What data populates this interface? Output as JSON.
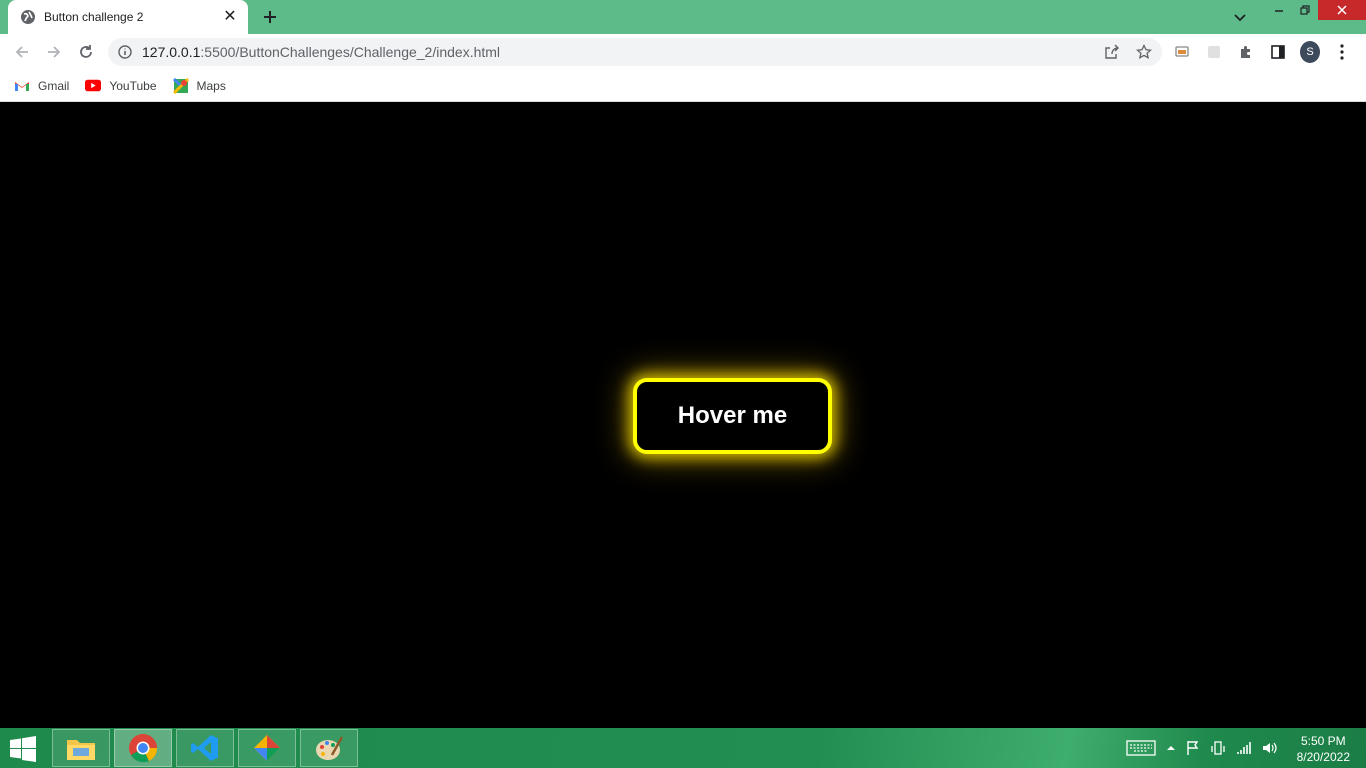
{
  "browser": {
    "tab_title": "Button challenge 2",
    "url_host": "127.0.0.1",
    "url_path": ":5500/ButtonChallenges/Challenge_2/index.html",
    "avatar_letter": "S",
    "bookmarks": [
      {
        "label": "Gmail",
        "icon": "gmail-icon"
      },
      {
        "label": "YouTube",
        "icon": "youtube-icon"
      },
      {
        "label": "Maps",
        "icon": "maps-icon"
      }
    ]
  },
  "page": {
    "button_label": "Hover me",
    "button_border_color": "#ffff00",
    "background_color": "#000000"
  },
  "taskbar": {
    "apps": [
      "file-explorer",
      "chrome",
      "vscode",
      "git-app",
      "paint"
    ],
    "time": "5:50 PM",
    "date": "8/20/2022"
  }
}
